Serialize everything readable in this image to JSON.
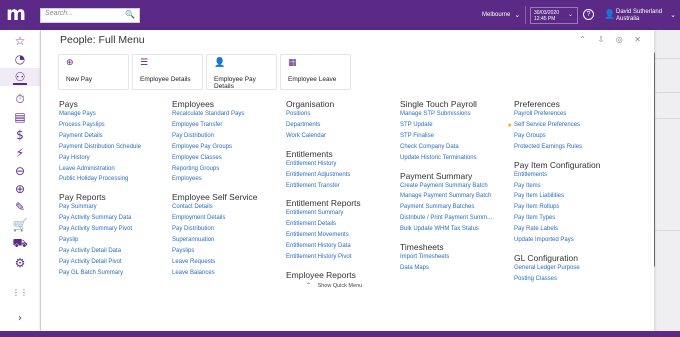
{
  "topbar": {
    "logo_letter": "m",
    "search_placeholder": "Search...",
    "search_icon": "🔍",
    "location": "Melbourne",
    "date": "30/03/2020",
    "time": "12:45 PM",
    "help_glyph": "?",
    "user_name": "David Sutherland",
    "user_location": "Australia",
    "chevron": "⌄"
  },
  "sidebar_icons": [
    "star-icon",
    "history-icon",
    "people-icon",
    "stopwatch-icon",
    "clipboard-icon",
    "dollar-icon",
    "lightning-icon",
    "minus-circle-icon",
    "plus-circle-icon",
    "edit-icon",
    "cart-icon",
    "truck-icon",
    "gear-icon",
    "apps-icon"
  ],
  "sidebar_glyphs": [
    "☆",
    "◔",
    "⚇",
    "⏱",
    "▤",
    "$",
    "⚡",
    "⊖",
    "⊕",
    "✎",
    "🛒",
    "⛟",
    "⚙",
    "⋮⋮"
  ],
  "sidebar_expand_glyph": "›",
  "panel": {
    "title": "People: Full Menu",
    "actions": [
      "⌃",
      "⇩",
      "◎",
      "✕"
    ],
    "quick_menu_glyph": "⌃",
    "quick_menu_label": "Show Quick Menu"
  },
  "cards": [
    {
      "label": "New Pay",
      "icon": "⊕"
    },
    {
      "label": "Employee Details",
      "icon": "☰"
    },
    {
      "label": "Employee Pay Details",
      "icon": "👤"
    },
    {
      "label": "Employee Leave",
      "icon": "▦"
    }
  ],
  "columns": [
    {
      "sections": [
        {
          "heading": "Pays",
          "items": [
            "Manage Pays",
            "Process Payslips",
            "Payment Details",
            "Payment Distribution Schedule",
            "Pay History",
            "Leave Administration",
            "Public Holiday Processing"
          ]
        },
        {
          "heading": "Pay Reports",
          "items": [
            "Pay Summary",
            "Pay Activity Summary Data",
            "Pay Activity Summary Pivot",
            "Payslip",
            "Pay Activity Detail Data",
            "Pay Activity Detail Pivot",
            "Pay GL Batch Summary"
          ]
        }
      ]
    },
    {
      "sections": [
        {
          "heading": "Employees",
          "items": [
            "Recalculate Standard Pays",
            "Employee Transfer",
            "Pay Distribution",
            "Employee Pay Groups",
            "Employee Classes",
            "Reporting Groups",
            "Employees"
          ]
        },
        {
          "heading": "Employee Self Service",
          "items": [
            "Contact Details",
            "Employment Details",
            "Pay Distribution",
            "Superannuation",
            "Payslips",
            "Leave Requests",
            "Leave Balances"
          ]
        }
      ]
    },
    {
      "sections": [
        {
          "heading": "Organisation",
          "items": [
            "Positions",
            "Departments",
            "Work Calendar"
          ]
        },
        {
          "heading": "Entitlements",
          "items": [
            "Entitlement History",
            "Entitlement Adjustments",
            "Entitlement Transfer"
          ]
        },
        {
          "heading": "Entitlement Reports",
          "items": [
            "Entitlement Summary",
            "Entitlement Details",
            "Entitlement Movements",
            "Entitlement History Data",
            "Entitlement History Pivot"
          ]
        },
        {
          "heading": "Employee Reports",
          "items": []
        }
      ]
    },
    {
      "sections": [
        {
          "heading": "Single Touch Payroll",
          "items": [
            "Manage STP Submissions",
            "STP Update",
            "STP Finalise",
            "Check Company Data",
            "Update Historic Terminations"
          ]
        },
        {
          "heading": "Payment Summary",
          "items": [
            "Create Payment Summary Batch",
            "Manage Payment Summary Batch",
            "Payment Summary Batches",
            "Distribute / Print Payment Summ...",
            "Bulk Update WHM Tax Status"
          ]
        },
        {
          "heading": "Timesheets",
          "items": [
            "Import Timesheets",
            "Data Maps"
          ]
        }
      ]
    },
    {
      "sections": [
        {
          "heading": "Preferences",
          "items": [
            "Payroll Preferences",
            "Self Service Preferences",
            "Pay Groups",
            "Protected Earnings Rules"
          ]
        },
        {
          "heading": "Pay Item Configuration",
          "items": [
            "Entitlements",
            "Pay Items",
            "Pay Item Liabilities",
            "Pay Item Rollups",
            "Pay Item Types",
            "Pay Rate Labels",
            "Update Imported Pays"
          ]
        },
        {
          "heading": "GL Configuration",
          "items": [
            "General Ledger Purpose",
            "Posting Classes"
          ]
        }
      ]
    }
  ],
  "starred_item": "Self Service Preferences",
  "colors": {
    "brand": "#5b2a86",
    "link": "#2b6dbf",
    "star": "#f0a800"
  }
}
